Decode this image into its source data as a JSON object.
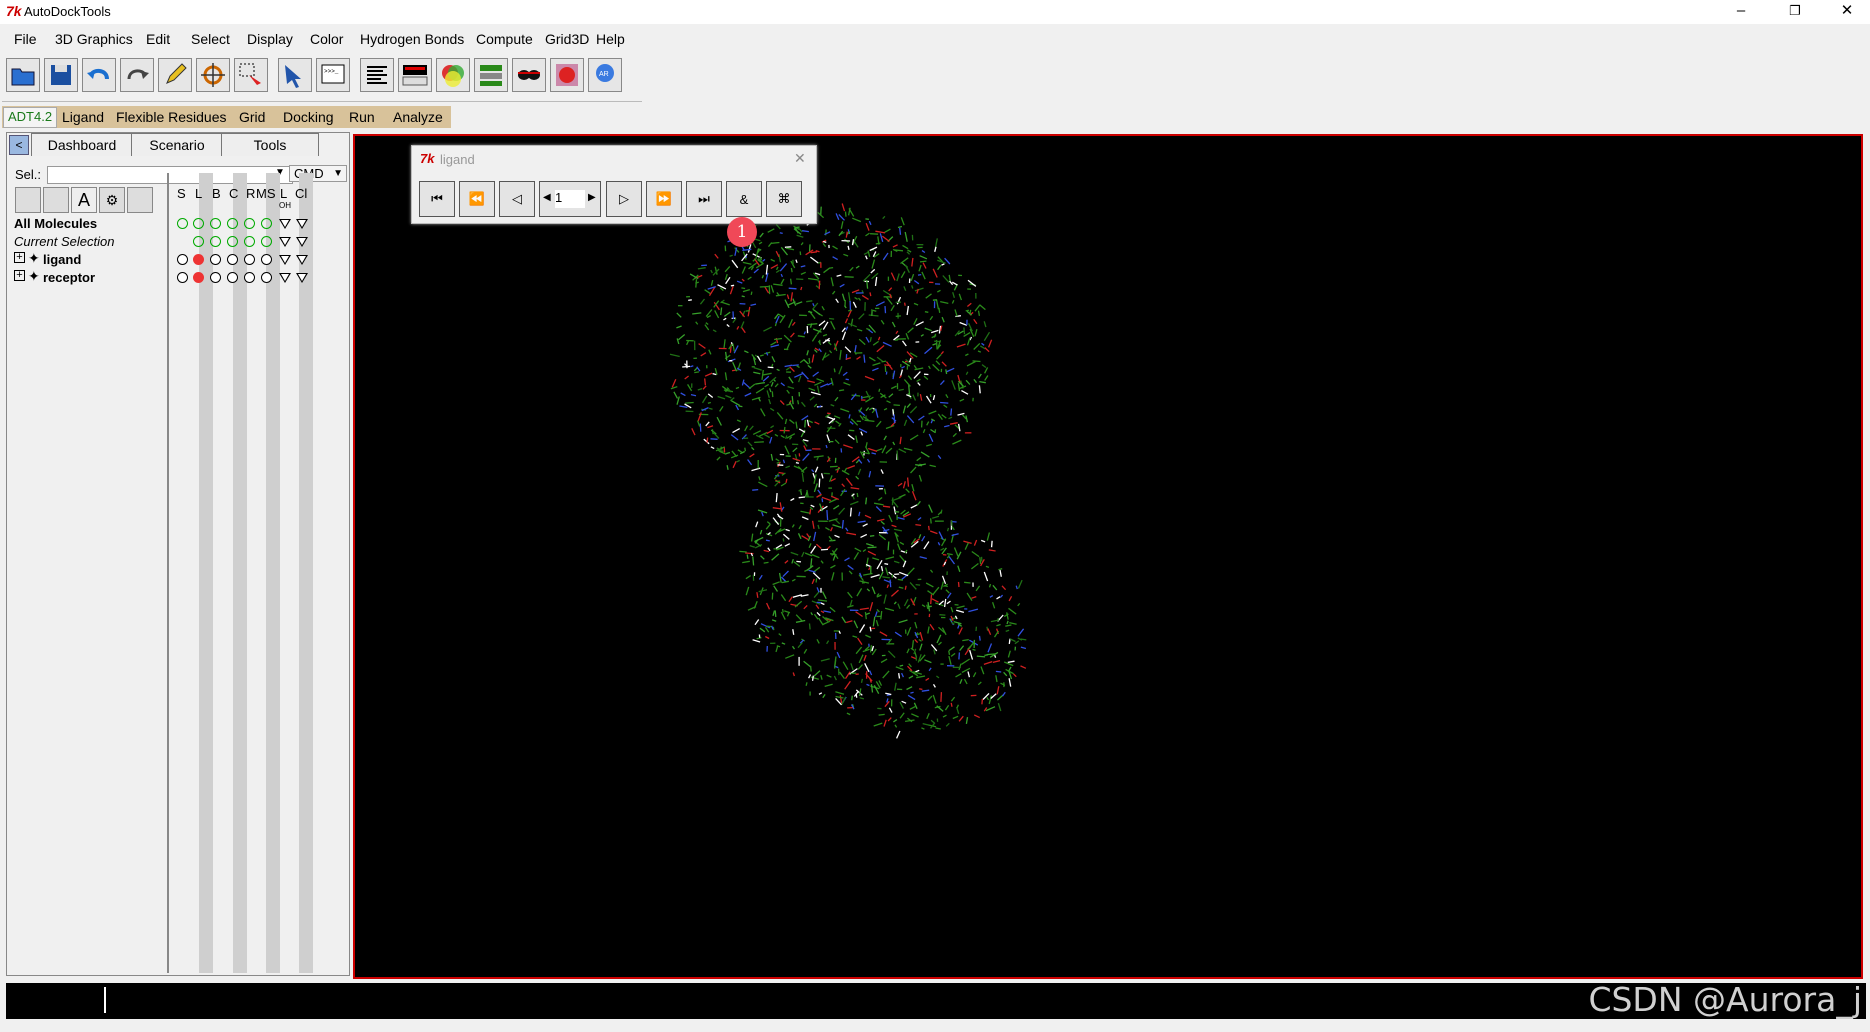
{
  "window": {
    "title": "AutoDockTools",
    "controls": [
      "–",
      "❐",
      "✕"
    ]
  },
  "menubar": [
    "File",
    "3D Graphics",
    "Edit",
    "Select",
    "Display",
    "Color",
    "Hydrogen Bonds",
    "Compute",
    "Grid3D",
    "Help"
  ],
  "adt_bar": {
    "version": "ADT4.2",
    "items": [
      "Ligand",
      "Flexible Residues",
      "Grid",
      "Docking",
      "Run",
      "Analyze"
    ]
  },
  "dashboard": {
    "tabs": [
      "Dashboard",
      "Scenario",
      "Tools"
    ],
    "sel_label": "Sel.:",
    "cmd_label": "CMD",
    "columns": [
      "S",
      "L",
      "B",
      "C",
      "R",
      "MS",
      "L",
      "Cl"
    ],
    "column_sublabels": [
      "",
      "",
      "",
      "",
      "",
      "",
      "OH",
      ""
    ],
    "tree": [
      {
        "label": "All Molecules"
      },
      {
        "label": "Current Selection"
      },
      {
        "label": "ligand"
      },
      {
        "label": "receptor"
      }
    ]
  },
  "player": {
    "title": "ligand",
    "frame": "1",
    "badge": "1"
  },
  "watermark": "CSDN @Aurora_j",
  "colors": {
    "accent_red": "#cc0000",
    "adt_bar": "#d8c29a",
    "badge": "#f04858",
    "molecule_green": "#2a8a1a"
  }
}
